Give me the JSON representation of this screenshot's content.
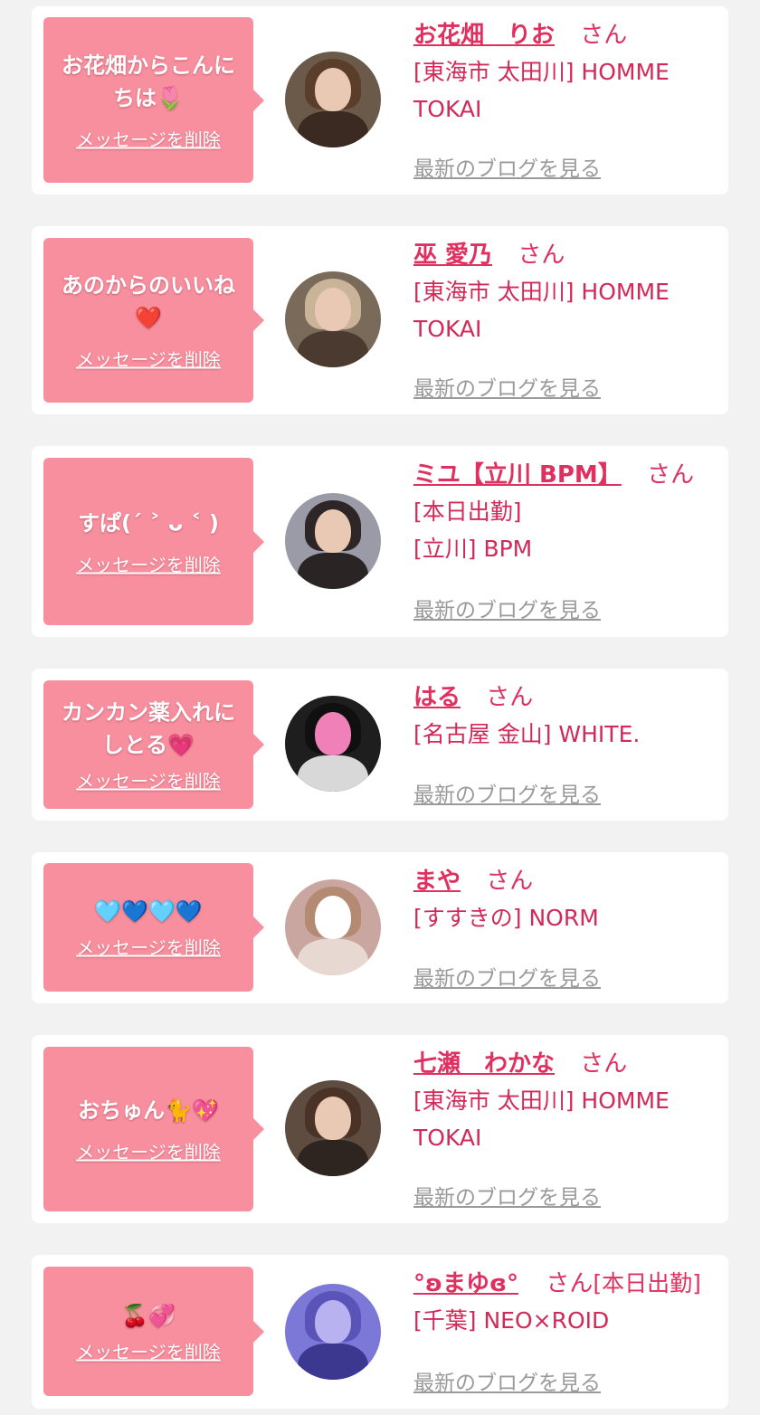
{
  "labels": {
    "delete": "メッセージを削除",
    "blog": "最新のブログを見る",
    "san": "さん"
  },
  "colors": {
    "page_bg": "#f2f2f2",
    "bubble": "#f88f9e",
    "name_accent": "#e0305f",
    "blog_link": "#9a9a9a"
  },
  "entries": [
    {
      "message": [
        "お花畑からこんに",
        "ちは🌷"
      ],
      "name": "お花畑　りお",
      "shop_lines": [
        "[東海市 太田川] HOMME",
        "TOKAI"
      ],
      "avatar_icon": "woman-portrait-icon"
    },
    {
      "message": [
        "あのからのいいね",
        "❤️"
      ],
      "name": "巫 愛乃",
      "shop_lines": [
        "[東海市 太田川] HOMME",
        "TOKAI"
      ],
      "avatar_icon": "woman-portrait-icon"
    },
    {
      "message": [
        "すぱ(ˊ ˃ ᴗ ˂ )"
      ],
      "name": "ミユ【立川 BPM】",
      "shop_lines": [
        "[本日出勤]",
        "[立川] BPM"
      ],
      "avatar_icon": "woman-portrait-icon"
    },
    {
      "message": [
        "カンカン薬入れに",
        "しとる💗"
      ],
      "name": "はる",
      "shop_lines": [
        "[名古屋 金山] WHITE."
      ],
      "avatar_icon": "woman-portrait-icon"
    },
    {
      "message": [
        "🩵💙🩵💙"
      ],
      "name": "まや",
      "shop_lines": [
        "[すすきの] NORM"
      ],
      "avatar_icon": "woman-portrait-icon"
    },
    {
      "message": [
        "おちゅん🐈💖"
      ],
      "name": "七瀬　わかな",
      "shop_lines": [
        "[東海市 太田川] HOMME",
        "TOKAI"
      ],
      "avatar_icon": "woman-portrait-icon"
    },
    {
      "message": [
        "🍒💞"
      ],
      "name": "°ʚまゆɞ°",
      "name_suffix": "[本日出勤]",
      "shop_lines": [
        "[千葉] NEO×ROID"
      ],
      "avatar_icon": "woman-portrait-icon"
    }
  ]
}
